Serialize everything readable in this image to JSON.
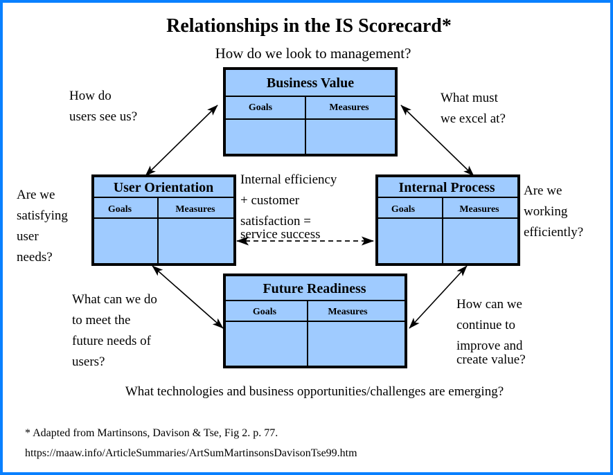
{
  "page": {
    "border_color": "#0a80ff",
    "background": "#ffffff"
  },
  "header": {
    "title": "Relationships in the IS Scorecard*",
    "subtitle": "How do we look to management?"
  },
  "boxes": [
    {
      "id": "business-value",
      "title": "Business Value",
      "columns": [
        "Goals",
        "Measures"
      ],
      "fill": "#9fcbff"
    },
    {
      "id": "user-orientation",
      "title": "User Orientation",
      "columns": [
        "Goals",
        "Measures"
      ],
      "fill": "#9fcbff"
    },
    {
      "id": "internal-process",
      "title": "Internal Process",
      "columns": [
        "Goals",
        "Measures"
      ],
      "fill": "#9fcbff"
    },
    {
      "id": "future-readiness",
      "title": "Future Readiness",
      "columns": [
        "Goals",
        "Measures"
      ],
      "fill": "#9fcbff"
    }
  ],
  "annotations": {
    "top_left": [
      "How do",
      "users see us?"
    ],
    "top_right": [
      "What must",
      "we excel at?"
    ],
    "left": [
      "Are we",
      "satisfying",
      "user",
      "needs?"
    ],
    "center": [
      "Internal efficiency",
      "+ customer",
      "satisfaction =",
      "service success"
    ],
    "right": [
      "Are we",
      "working",
      "efficiently?"
    ],
    "bottom_left": [
      "What can we do",
      "to meet the",
      "future needs of",
      "users?"
    ],
    "bottom_right": [
      "How can we",
      "continue to",
      "improve and",
      "create value?"
    ]
  },
  "caption": "What technologies and business opportunities/challenges are emerging?",
  "footnote": {
    "line1": "* Adapted from Martinsons, Davison & Tse, Fig 2.  p. 77.",
    "line2": "https://maaw.info/ArticleSummaries/ArtSumMartinsonsDavisonTse99.htm"
  }
}
